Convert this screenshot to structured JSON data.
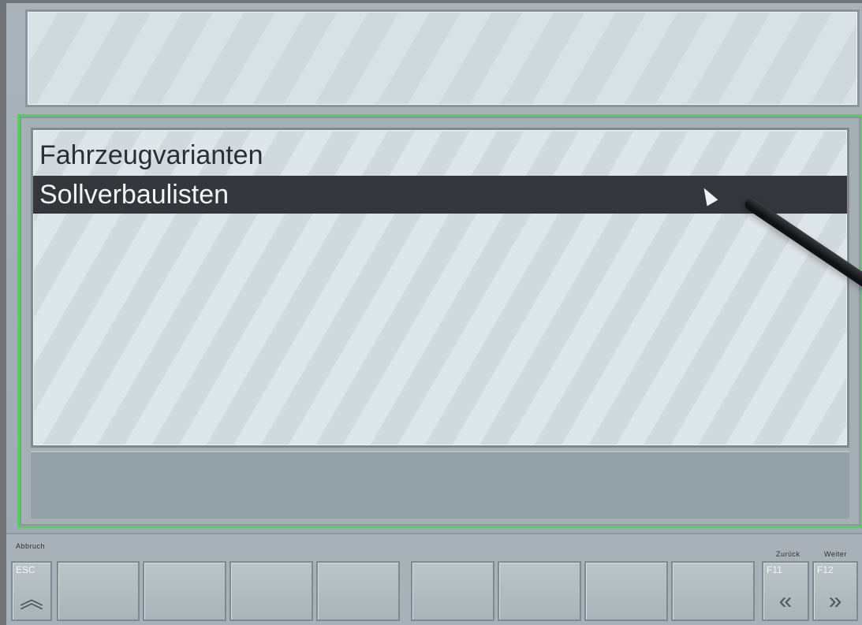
{
  "list": {
    "items": [
      "Fahrzeugvarianten",
      "Sollverbaulisten"
    ],
    "selected_index": 1
  },
  "function_bar": {
    "left_label": "Abbruch",
    "esc_key": "ESC",
    "back_label": "Zurück",
    "next_label": "Weiter",
    "f11_key": "F11",
    "f12_key": "F12"
  },
  "icons": {
    "esc_icon": "double-chevron-up-icon",
    "back_icon": "double-chevron-left-icon",
    "next_icon": "double-chevron-right-icon",
    "cursor_icon": "pointer-cursor-icon"
  },
  "colors": {
    "selection_background": "#34363b",
    "frame_accent": "#4fd15a"
  }
}
